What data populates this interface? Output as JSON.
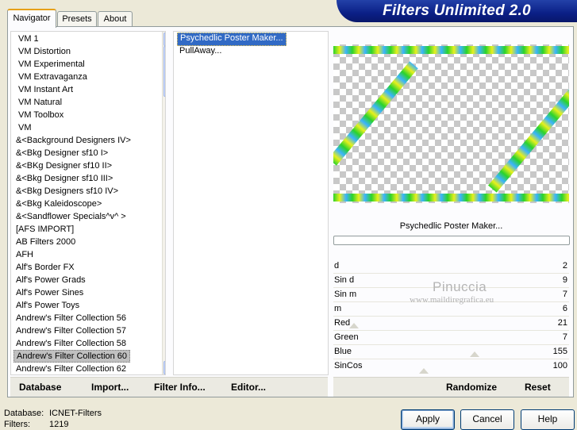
{
  "banner": {
    "title": "Filters Unlimited 2.0"
  },
  "tabs": [
    {
      "label": "Navigator",
      "active": true
    },
    {
      "label": "Presets",
      "active": false
    },
    {
      "label": "About",
      "active": false
    }
  ],
  "categories": [
    "VM 1",
    "VM Distortion",
    "VM Experimental",
    "VM Extravaganza",
    "VM Instant Art",
    "VM Natural",
    "VM Toolbox",
    "VM",
    "&<Background Designers IV>",
    "&<Bkg Designer sf10 I>",
    "&<BKg Designer sf10 II>",
    "&<Bkg Designer sf10 III>",
    "&<Bkg Designers sf10 IV>",
    "&<Bkg Kaleidoscope>",
    "&<Sandflower Specials^v^ >",
    "[AFS IMPORT]",
    "AB Filters 2000",
    "AFH",
    "Alf's Border FX",
    "Alf's Power Grads",
    "Alf's Power Sines",
    "Alf's Power Toys",
    "Andrew's Filter Collection 56",
    "Andrew's Filter Collection 57",
    "Andrew's Filter Collection 58",
    "Andrew's Filter Collection 60",
    "Andrew's Filter Collection 62"
  ],
  "selected_category": "Andrew's Filter Collection 60",
  "filters": [
    {
      "label": "Psychedlic Poster Maker...",
      "selected": true
    },
    {
      "label": "PullAway...",
      "selected": false
    }
  ],
  "filter_title": "Psychedlic Poster Maker...",
  "progress": 0,
  "params": [
    {
      "name": "d",
      "value": "2"
    },
    {
      "name": "Sin d",
      "value": "9"
    },
    {
      "name": "Sin m",
      "value": "7"
    },
    {
      "name": "m",
      "value": "6"
    },
    {
      "name": "Red",
      "value": "21"
    },
    {
      "name": "Green",
      "value": "7"
    },
    {
      "name": "Blue",
      "value": "155"
    },
    {
      "name": "SinCos",
      "value": "100"
    }
  ],
  "watermark": {
    "name": "Pinuccia",
    "url": "www.maildiregrafica.eu"
  },
  "toolbar_left": [
    "Database",
    "Import...",
    "Filter Info...",
    "Editor..."
  ],
  "toolbar_right": [
    "Randomize",
    "Reset"
  ],
  "status": {
    "database_label": "Database:",
    "database_value": "ICNET-Filters",
    "filters_label": "Filters:",
    "filters_value": "1219"
  },
  "buttons": {
    "apply": "Apply",
    "cancel": "Cancel",
    "help": "Help"
  },
  "colors": {
    "banner": "#0b1f86",
    "selection": "#316ac5",
    "preview_stripe_green": "#2bd32b",
    "preview_stripe_blue": "#3bb3ff"
  }
}
